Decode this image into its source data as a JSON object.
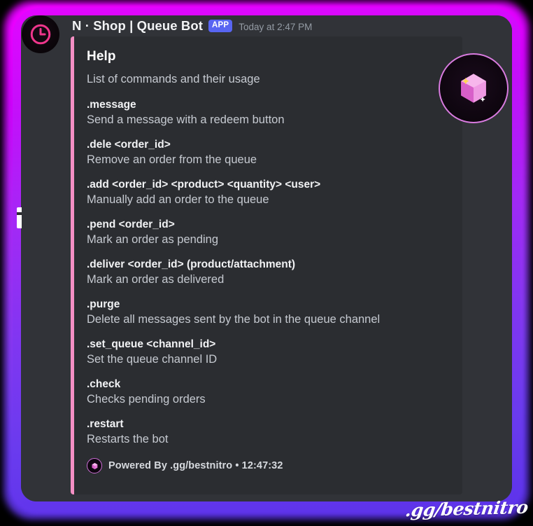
{
  "message": {
    "username": "N · Shop | Queue Bot",
    "app_badge": "APP",
    "timestamp": "Today at 2:47 PM",
    "avatar_icon": "clock-icon"
  },
  "embed": {
    "accent_color": "#f48fc4",
    "title": "Help",
    "description": "List of commands and their usage",
    "thumbnail_icon": "pink-gem-icon",
    "fields": [
      {
        "name": ".message",
        "value": "Send a message with a redeem button"
      },
      {
        "name": ".dele <order_id>",
        "value": "Remove an order from the queue"
      },
      {
        "name": ".add <order_id> <product> <quantity> <user>",
        "value": "Manually add an order to the queue"
      },
      {
        "name": ".pend <order_id>",
        "value": "Mark an order as pending"
      },
      {
        "name": ".deliver <order_id> (product/attachment)",
        "value": "Mark an order as delivered"
      },
      {
        "name": ".purge",
        "value": "Delete all messages sent by the bot in the queue channel"
      },
      {
        "name": ".set_queue <channel_id>",
        "value": "Set the queue channel ID"
      },
      {
        "name": ".check",
        "value": "Checks pending orders"
      },
      {
        "name": ".restart",
        "value": "Restarts the bot"
      }
    ],
    "footer": {
      "text": "Powered By .gg/bestnitro • 12:47:32",
      "icon": "pink-gem-icon"
    }
  },
  "watermark": {
    "text": ".gg/bestnitro"
  },
  "colors": {
    "frame_top": "#e600ff",
    "frame_bottom": "#5b32ea",
    "embed_bg": "#2b2d31",
    "panel_bg": "#313338",
    "badge_blurple": "#5865f2",
    "accent_pink": "#f48fc4"
  }
}
